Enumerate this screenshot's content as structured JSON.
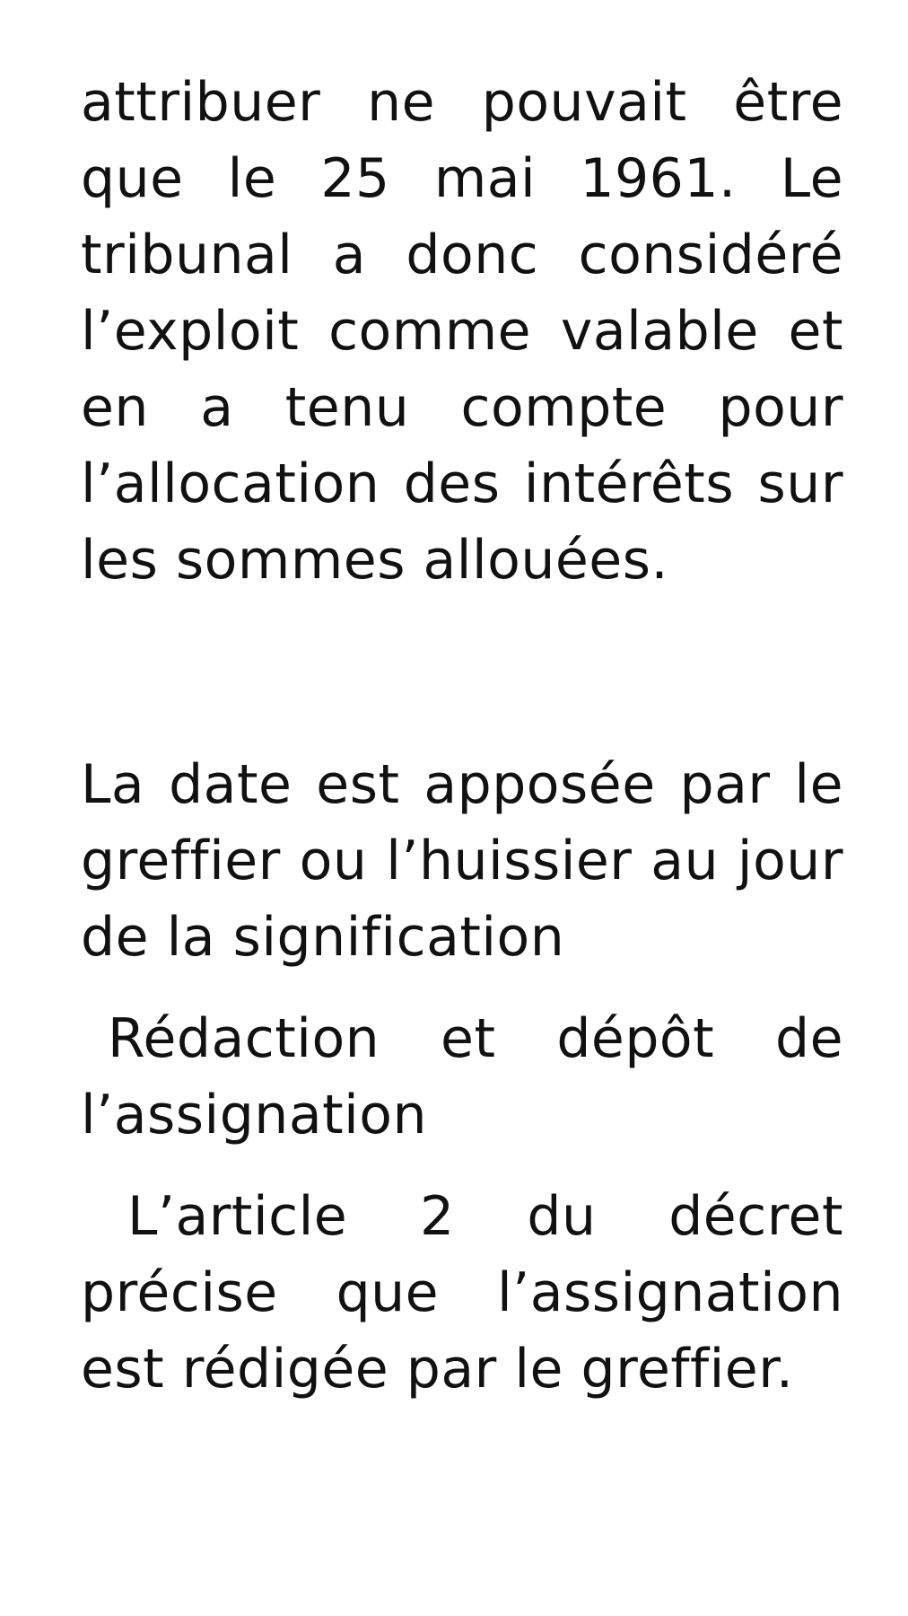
{
  "paragraphs": [
    "attribuer ne pouvait être que le 25 mai 1961. Le tribunal a donc considéré l’exploit comme valable et en a tenu compte pour l’allocation des intérêts sur les sommes allouées.",
    "La date est apposée par le greffier ou l’huissier au jour de la signification",
    "Rédaction et dépôt de l’assignation",
    "L’article 2 du décret précise que l’assignation est rédigée par le greffier."
  ]
}
